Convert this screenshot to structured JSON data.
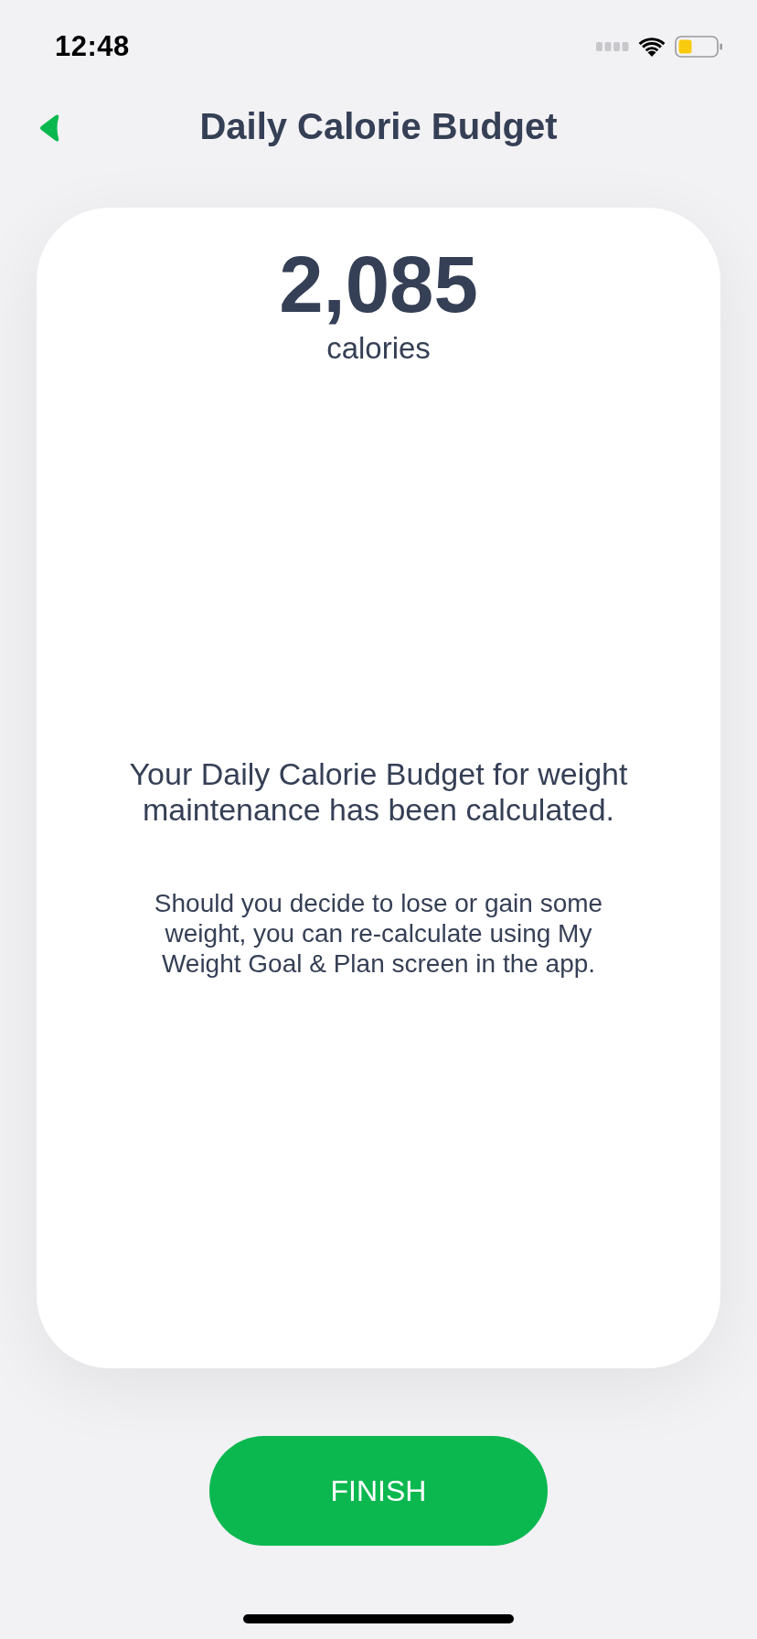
{
  "status_bar": {
    "time": "12:48"
  },
  "header": {
    "title": "Daily Calorie Budget"
  },
  "budget": {
    "value": "2,085",
    "unit": "calories",
    "message": "Your Daily Calorie Budget for weight maintenance has been calculated.",
    "note": "Should you decide to lose or gain some weight, you can re-calculate using My Weight Goal & Plan screen in the app."
  },
  "buttons": [
    {
      "label": "FINISH"
    }
  ]
}
